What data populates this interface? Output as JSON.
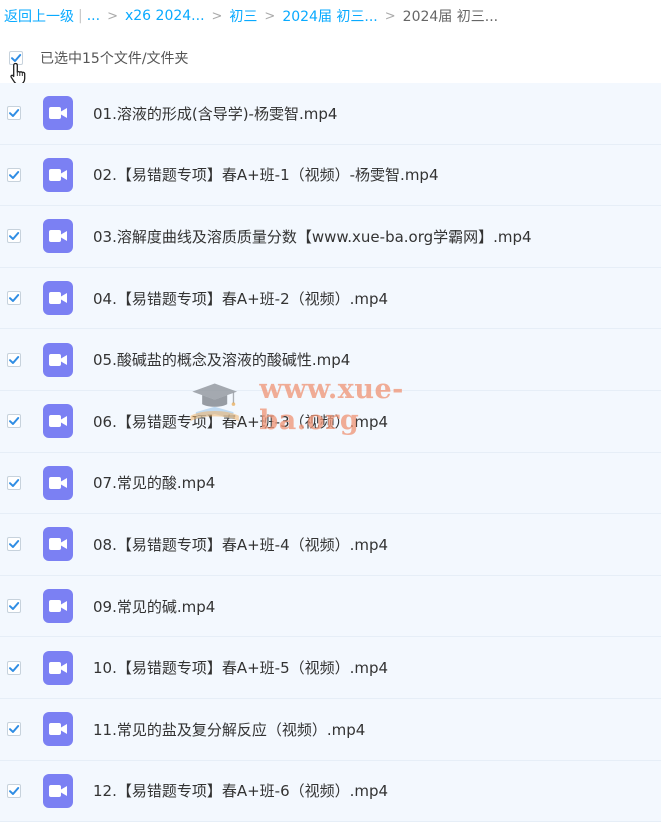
{
  "breadcrumb": {
    "back": "返回上一级",
    "ellipsis": "...",
    "items": [
      "x26 2024...",
      "初三",
      "2024届 初三..."
    ],
    "current": "2024届 初三..."
  },
  "selection": {
    "label": "已选中15个文件/文件夹"
  },
  "files": [
    {
      "name": "01.溶液的形成(含导学)-杨雯智.mp4"
    },
    {
      "name": "02.【易错题专项】春A+班-1（视频）-杨雯智.mp4"
    },
    {
      "name": "03.溶解度曲线及溶质质量分数【www.xue-ba.org学霸网】.mp4"
    },
    {
      "name": "04.【易错题专项】春A+班-2（视频）.mp4"
    },
    {
      "name": "05.酸碱盐的概念及溶液的酸碱性.mp4"
    },
    {
      "name": "06.【易错题专项】春A+班-3（视频）.mp4"
    },
    {
      "name": "07.常见的酸.mp4"
    },
    {
      "name": "08.【易错题专项】春A+班-4（视频）.mp4"
    },
    {
      "name": "09.常见的碱.mp4"
    },
    {
      "name": "10.【易错题专项】春A+班-5（视频）.mp4"
    },
    {
      "name": "11.常见的盐及复分解反应（视频）.mp4"
    },
    {
      "name": "12.【易错题专项】春A+班-6（视频）.mp4"
    }
  ],
  "watermark": {
    "text": "www.xue-ba.org"
  },
  "colors": {
    "link": "#09aaff",
    "check": "#2f8de4",
    "row_bg": "#f3f8fe",
    "file_icon": "#7b80f3"
  },
  "icons": {
    "checkbox": "checkmark-icon",
    "file": "video-file-icon",
    "cursor": "hand-pointer-icon"
  }
}
